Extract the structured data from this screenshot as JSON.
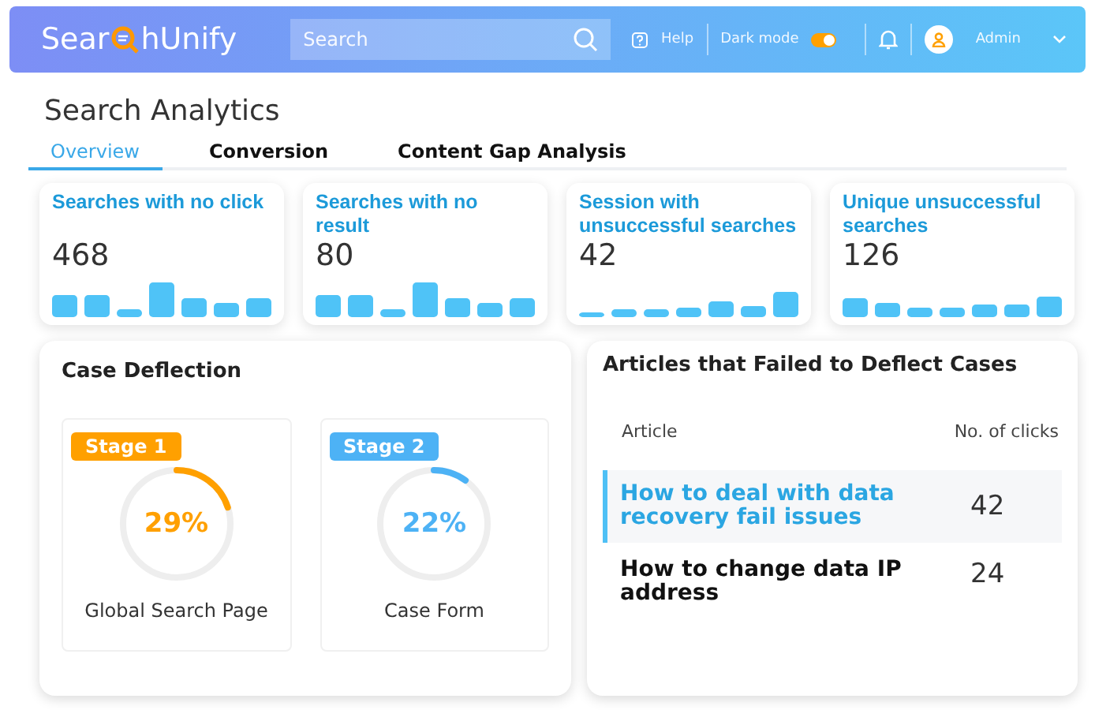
{
  "header": {
    "logo_left": "Sear",
    "logo_right": "hUnify",
    "search": {
      "placeholder": "Search"
    },
    "help": "Help",
    "dark_mode": {
      "label": "Dark mode",
      "on": true
    },
    "user": "Admin"
  },
  "page_title": "Search Analytics",
  "tabs": [
    {
      "label": "Overview",
      "selected": true
    },
    {
      "label": "Conversion",
      "selected": false
    },
    {
      "label": "Content Gap Analysis",
      "selected": false
    }
  ],
  "metrics": [
    {
      "title": "Searches with no click",
      "value": "468"
    },
    {
      "title": "Searches with no result",
      "value": "80"
    },
    {
      "title": "Session with unsuccessful searches",
      "value": "42"
    },
    {
      "title": "Unique unsuccessful searches",
      "value": "126"
    }
  ],
  "case_deflection": {
    "title": "Case Deflection",
    "stages": [
      {
        "badge": "Stage 1",
        "color": "#ffa000",
        "percent": "29%",
        "level": 0.2,
        "label": "Global Search Page"
      },
      {
        "badge": "Stage 2",
        "color": "#4db2f5",
        "percent": "22%",
        "level": 0.1,
        "label": "Case Form"
      }
    ]
  },
  "articles": {
    "title": "Articles that Failed to Deflect Cases",
    "columns": [
      "Article",
      "No. of clicks"
    ],
    "rows": [
      {
        "article": "How to deal with data recovery fail issues",
        "clicks": "42",
        "selected": true
      },
      {
        "article": "How to change data IP address",
        "clicks": "24",
        "selected": false
      }
    ]
  }
}
